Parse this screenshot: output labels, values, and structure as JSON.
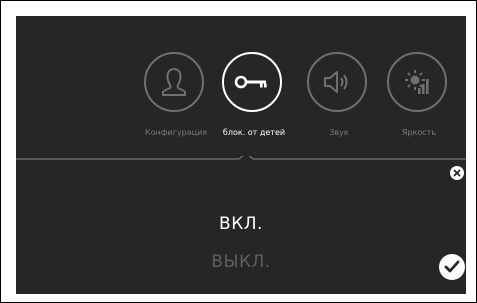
{
  "menu": {
    "items": [
      {
        "label": "Конфигурация",
        "icon": "user-icon",
        "active": false
      },
      {
        "label": "блок. от детей",
        "icon": "key-icon",
        "active": true
      },
      {
        "label": "Звук",
        "icon": "speaker-icon",
        "active": false
      },
      {
        "label": "Яркость",
        "icon": "brightness-icon",
        "active": false
      }
    ]
  },
  "options": {
    "on_label": "ВКЛ.",
    "off_label": "ВЫКЛ.",
    "selected": "ВКЛ."
  },
  "colors": {
    "screen_bg": "#262626",
    "active": "#ffffff",
    "inactive": "#6f6f6f"
  }
}
